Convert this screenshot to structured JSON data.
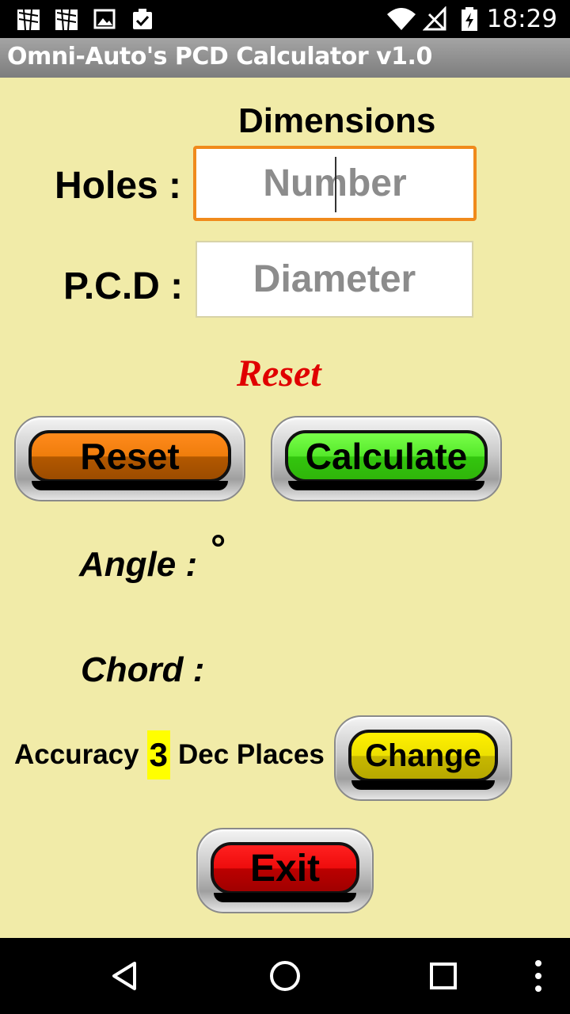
{
  "status_bar": {
    "time": "18:29",
    "left_icons": [
      "notification-icon",
      "notification-icon",
      "image-icon",
      "clipboard-check-icon"
    ],
    "right_icons": [
      "wifi-icon",
      "no-signal-icon",
      "battery-charging-icon"
    ]
  },
  "app": {
    "title": "Omni-Auto's PCD Calculator v1.0"
  },
  "form": {
    "heading": "Dimensions",
    "holes_label": "Holes :",
    "holes_placeholder": "Number",
    "pcd_label": "P.C.D :",
    "pcd_placeholder": "Diameter",
    "status_text": "Reset"
  },
  "buttons": {
    "reset": "Reset",
    "calculate": "Calculate",
    "change": "Change",
    "exit": "Exit"
  },
  "results": {
    "angle_label": "Angle :",
    "angle_unit": "°",
    "chord_label": "Chord :"
  },
  "accuracy": {
    "prefix": "Accuracy",
    "value": "3",
    "suffix": "Dec Places"
  },
  "colors": {
    "background": "#f1eba8",
    "reset": "#ef7d0c",
    "calculate": "#54e82a",
    "change": "#ece000",
    "exit": "#ee0c0c",
    "status_text": "#e00000"
  },
  "nav_bar": {
    "icons": [
      "back-icon",
      "home-icon",
      "recents-icon",
      "more-icon"
    ]
  }
}
